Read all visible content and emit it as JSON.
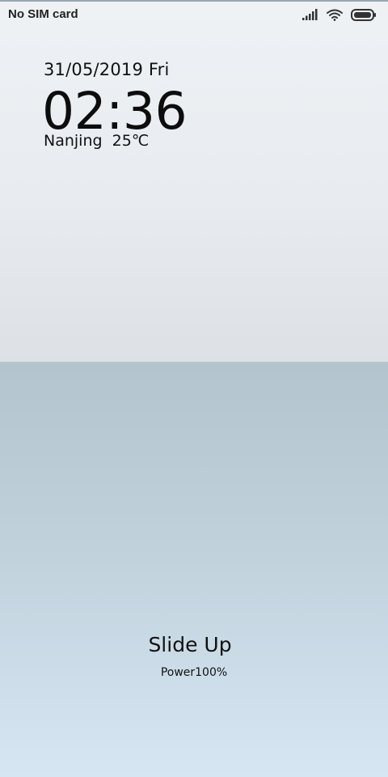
{
  "status_bar": {
    "carrier": "No SIM card",
    "icons": [
      "signal-icon",
      "wifi-icon",
      "battery-icon"
    ],
    "battery_level_percent": 100
  },
  "lock_screen": {
    "date": "31/05/2019 Fri",
    "time": "02:36",
    "weather": "Nanjing  25℃",
    "slide_prompt": "Slide Up",
    "power": "Power100%"
  },
  "colors": {
    "top_background": "#e8ecf0",
    "bottom_background": "#c0d1dc",
    "text": "#111111"
  }
}
